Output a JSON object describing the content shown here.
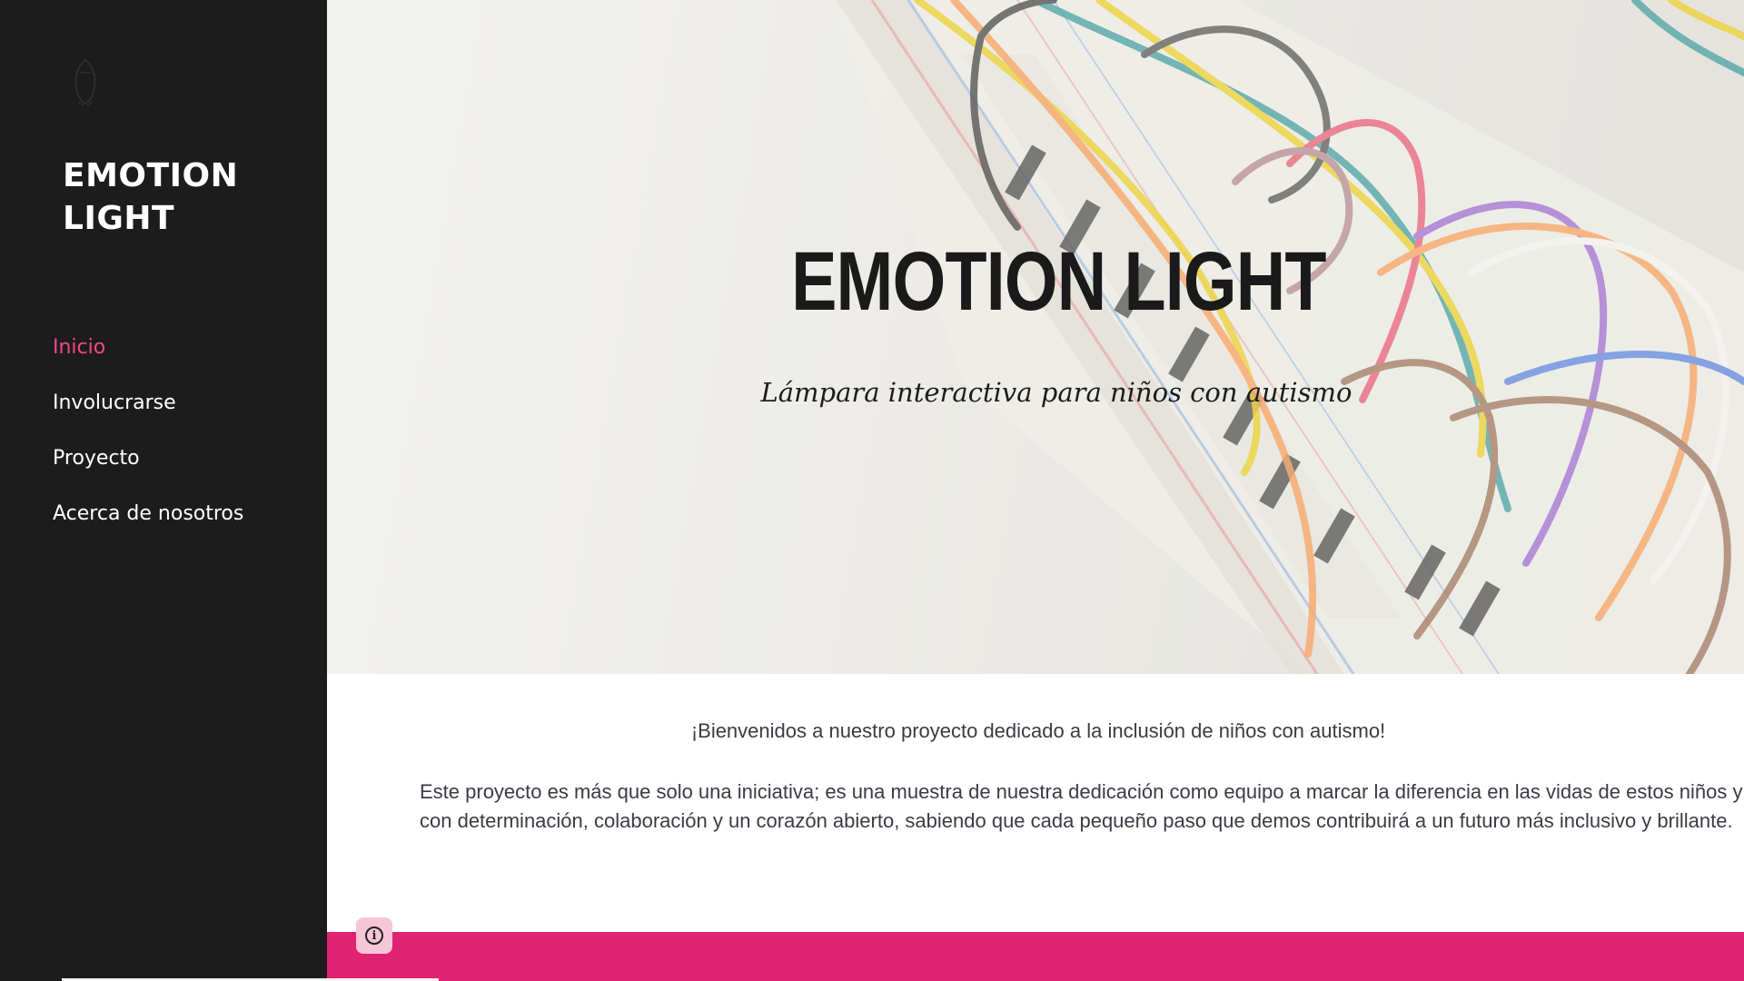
{
  "sidebar": {
    "logo_icon": "penguin-icon",
    "site_title": "EMOTION\nLIGHT",
    "nav": [
      {
        "label": "Inicio",
        "active": true
      },
      {
        "label": "Involucrarse",
        "active": false
      },
      {
        "label": "Proyecto",
        "active": false
      },
      {
        "label": "Acerca de nosotros",
        "active": false
      }
    ]
  },
  "hero": {
    "title": "EMOTION LIGHT",
    "subtitle": "Lámpara interactiva para niños con autismo",
    "image": "breadboard-with-colored-wires"
  },
  "content": {
    "welcome": "¡Bienvenidos a nuestro proyecto dedicado a la inclusión de niños con autismo!",
    "body": "Este proyecto es más que solo una iniciativa; es una muestra de nuestra dedicación como equipo a marcar la diferencia en las vidas de estos niños y sus familias. Sigamos adelante con determinación, colaboración y un corazón abierto, sabiendo que cada pequeño paso que demos contribuirá a un futuro más inclusivo y brillante."
  },
  "footer": {
    "info_icon": "info-icon"
  },
  "colors": {
    "sidebar_bg": "#1c1c1c",
    "active_nav": "#f0478c",
    "accent": "#e02272"
  }
}
